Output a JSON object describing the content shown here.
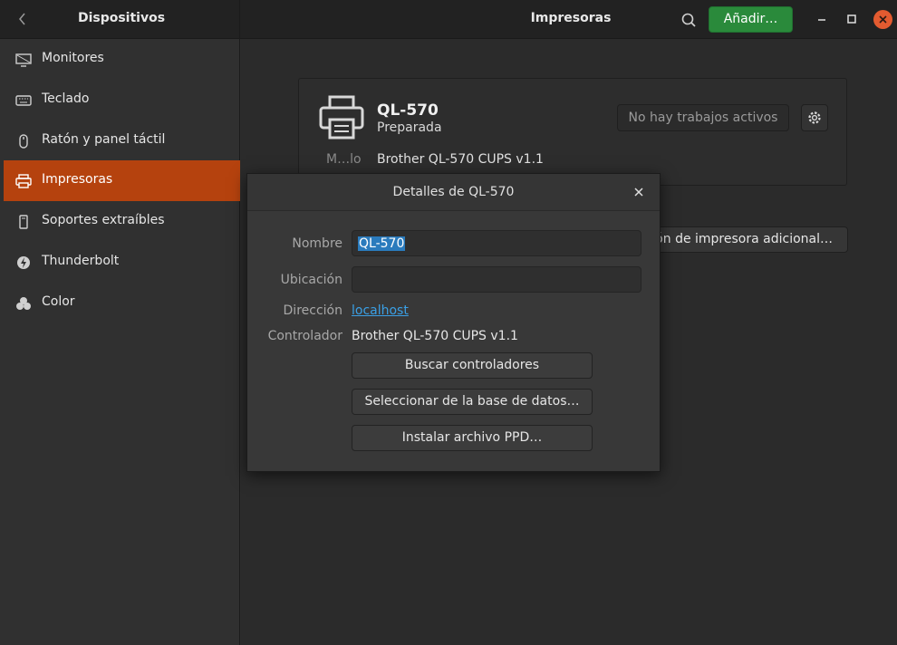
{
  "header": {
    "sidebar_title": "Dispositivos",
    "main_title": "Impresoras",
    "add_button": "Añadir…"
  },
  "sidebar": {
    "items": [
      {
        "label": "Monitores",
        "icon": "monitor-icon"
      },
      {
        "label": "Teclado",
        "icon": "keyboard-icon"
      },
      {
        "label": "Ratón y panel táctil",
        "icon": "mouse-icon"
      },
      {
        "label": "Impresoras",
        "icon": "printer-icon",
        "active": true
      },
      {
        "label": "Soportes extraíbles",
        "icon": "removable-media-icon"
      },
      {
        "label": "Thunderbolt",
        "icon": "thunderbolt-icon"
      },
      {
        "label": "Color",
        "icon": "color-icon"
      }
    ]
  },
  "printer": {
    "name": "QL-570",
    "status": "Preparada",
    "jobs_button": "No hay trabajos activos",
    "model_label": "M…lo",
    "model_value": "Brother QL-570 CUPS v1.1",
    "additional_button": "…ción de impresora adicional…"
  },
  "dialog": {
    "title": "Detalles de QL-570",
    "name_label": "Nombre",
    "name_value": "QL-570",
    "location_label": "Ubicación",
    "location_value": "",
    "address_label": "Dirección",
    "address_value": "localhost",
    "driver_label": "Controlador",
    "driver_value": "Brother QL-570 CUPS v1.1",
    "buttons": {
      "search_drivers": "Buscar controladores",
      "select_database": "Seleccionar de la base de datos…",
      "install_ppd": "Instalar archivo PPD…"
    }
  },
  "colors": {
    "accent": "#b5420e",
    "add_button": "#2a8a3b",
    "close_button": "#e35b30",
    "link": "#3aa0e6",
    "selection": "#2a7bbd"
  }
}
